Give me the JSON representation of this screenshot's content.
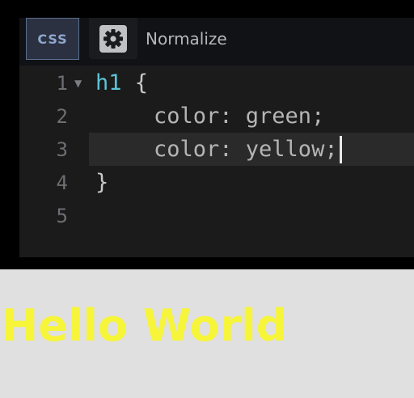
{
  "editor": {
    "language_tab": "CSS",
    "preprocessor_label": "Normalize",
    "icons": {
      "settings": "gear-icon",
      "fold": "fold-arrow-icon"
    },
    "lines": [
      {
        "number": "1",
        "text": "h1 {",
        "folded_marker": true
      },
      {
        "number": "2",
        "text": "color: green;"
      },
      {
        "number": "3",
        "text": "color: yellow;",
        "active": true
      },
      {
        "number": "4",
        "text": "}"
      },
      {
        "number": "5",
        "text": ""
      }
    ],
    "colors": {
      "selector": "#5cc3d6",
      "tab_text": "#8fa6cf",
      "tab_border": "#5a6f8f"
    }
  },
  "preview": {
    "heading_text": "Hello World",
    "heading_color": "#f6f53a",
    "background": "#e0e0e0"
  }
}
